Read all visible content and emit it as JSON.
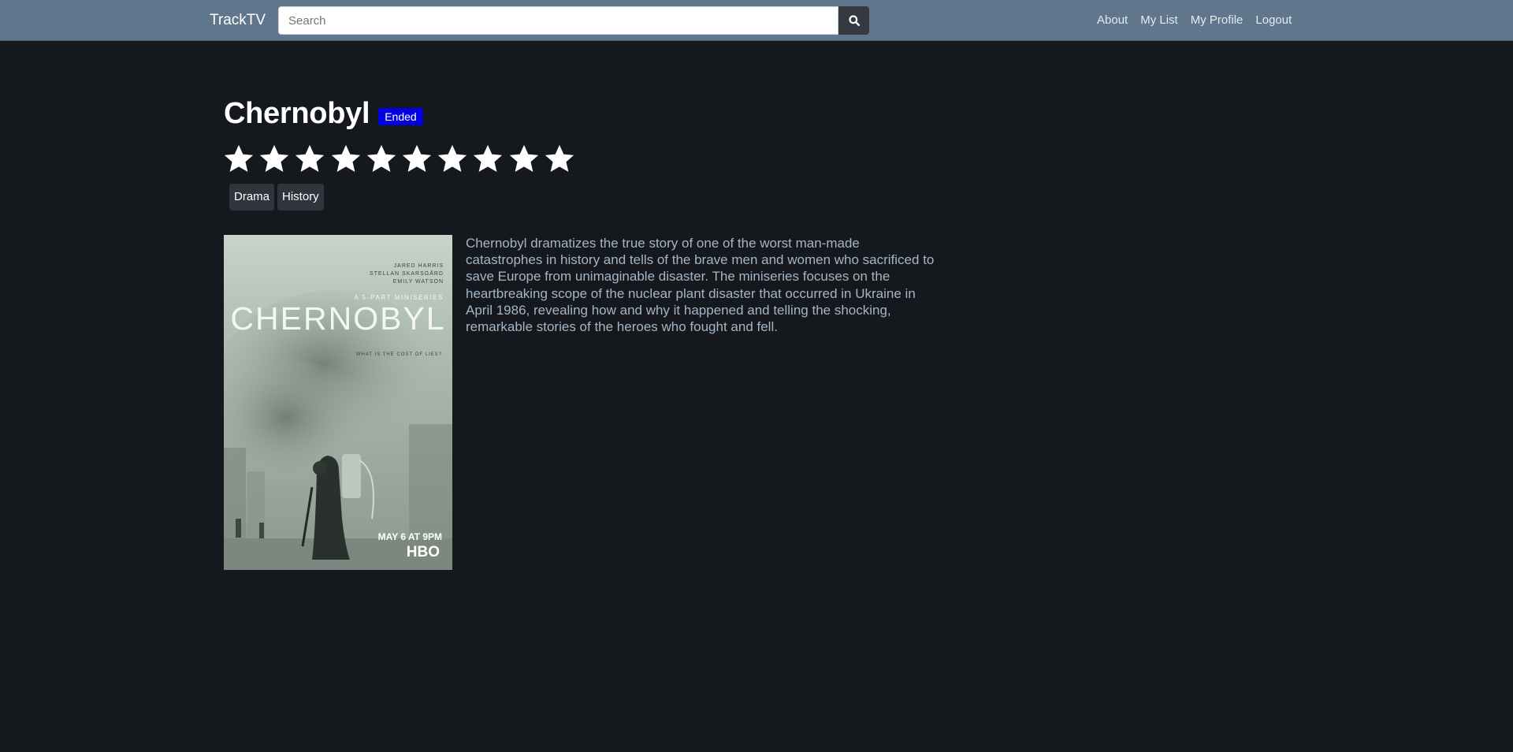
{
  "navbar": {
    "brand": "TrackTV",
    "search_placeholder": "Search",
    "search_icon": "search-icon",
    "links": [
      "About",
      "My List",
      "My Profile",
      "Logout"
    ]
  },
  "show": {
    "title": "Chernobyl",
    "status": "Ended",
    "rating": 10,
    "rating_max": 10,
    "genres": [
      "Drama",
      "History"
    ],
    "description": "Chernobyl dramatizes the true story of one of the worst man-made catastrophes in history and tells of the brave men and women who sacrificed to save Europe from unimaginable disaster. The miniseries focuses on the heartbreaking scope of the nuclear plant disaster that occurred in Ukraine in April 1986, revealing how and why it happened and telling the shocking, remarkable stories of the heroes who fought and fell."
  },
  "poster": {
    "cast": [
      "JARED HARRIS",
      "STELLAN SKARSGÅRD",
      "EMILY WATSON"
    ],
    "tagline_top": "A 5-PART MINISERIES",
    "title": "CHERNOBYL",
    "tagline": "WHAT IS THE COST OF LIES?",
    "date": "MAY 6 AT 9PM",
    "network": "HBO"
  },
  "colors": {
    "navbar_bg": "#5f768c",
    "page_bg": "#15181d",
    "badge_bg": "#0000e0",
    "genre_bg": "#2f353c",
    "description_text": "#a3b6c7"
  }
}
